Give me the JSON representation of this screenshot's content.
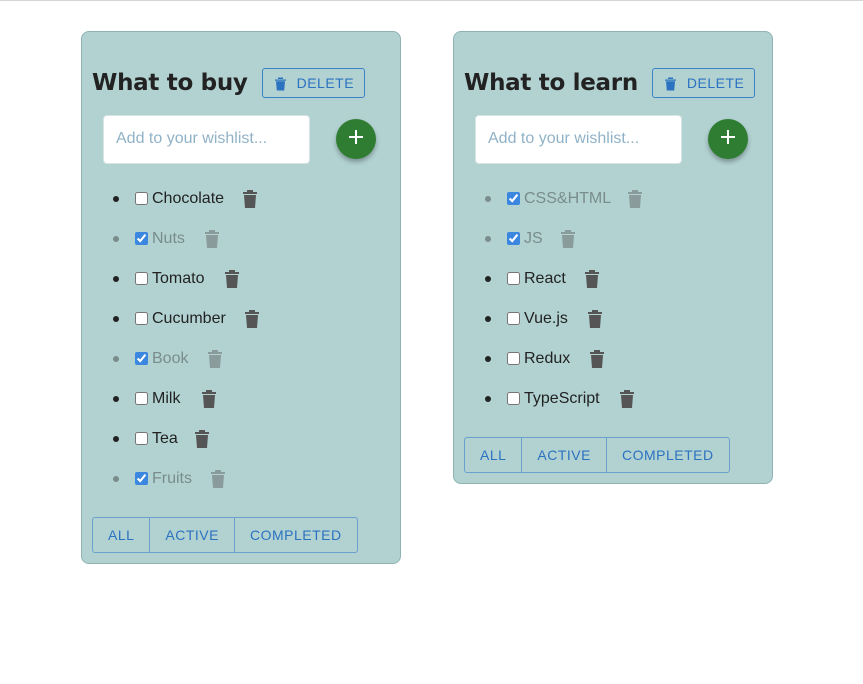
{
  "lists": [
    {
      "title": "What to buy",
      "delete_label": "DELETE",
      "input_placeholder": "Add to your wishlist...",
      "filters": [
        "ALL",
        "ACTIVE",
        "COMPLETED"
      ],
      "items": [
        {
          "label": "Chocolate",
          "done": false
        },
        {
          "label": "Nuts",
          "done": true
        },
        {
          "label": "Tomato",
          "done": false
        },
        {
          "label": "Cucumber",
          "done": false
        },
        {
          "label": "Book",
          "done": true
        },
        {
          "label": "Milk",
          "done": false
        },
        {
          "label": "Tea",
          "done": false
        },
        {
          "label": "Fruits",
          "done": true
        }
      ]
    },
    {
      "title": "What to learn",
      "delete_label": "DELETE",
      "input_placeholder": "Add to your wishlist...",
      "filters": [
        "ALL",
        "ACTIVE",
        "COMPLETED"
      ],
      "items": [
        {
          "label": "CSS&HTML",
          "done": true
        },
        {
          "label": "JS",
          "done": true
        },
        {
          "label": "React",
          "done": false
        },
        {
          "label": "Vue.js",
          "done": false
        },
        {
          "label": "Redux",
          "done": false
        },
        {
          "label": "TypeScript",
          "done": false
        }
      ]
    }
  ],
  "colors": {
    "card_bg": "#b2d2d2",
    "accent_blue": "#2b72c0",
    "add_button_green": "#2e7d32",
    "trash_gray": "#555555"
  },
  "icons": {
    "delete": "trash-icon",
    "add": "plus-icon",
    "item_delete": "trash-icon"
  }
}
